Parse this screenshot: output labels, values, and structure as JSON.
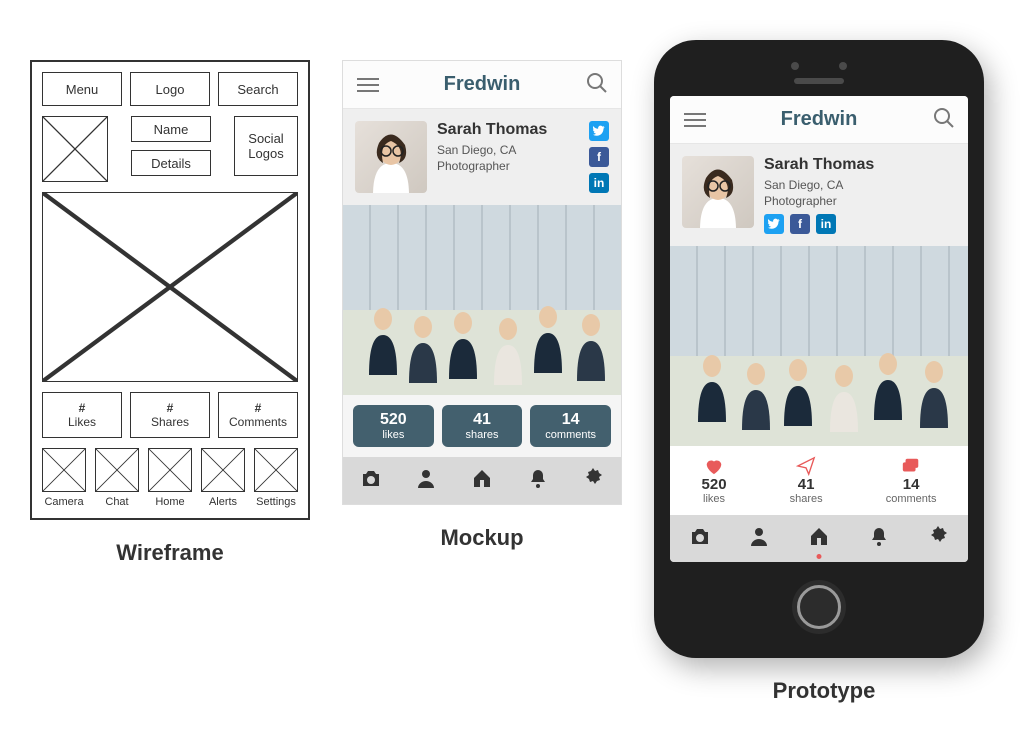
{
  "captions": {
    "wireframe": "Wireframe",
    "mockup": "Mockup",
    "prototype": "Prototype"
  },
  "wireframe": {
    "header": {
      "menu": "Menu",
      "logo": "Logo",
      "search": "Search"
    },
    "profile": {
      "name": "Name",
      "details": "Details",
      "social": "Social\nLogos"
    },
    "stats_prefix": "#",
    "stats": {
      "likes": "Likes",
      "shares": "Shares",
      "comments": "Comments"
    },
    "nav": {
      "camera": "Camera",
      "chat": "Chat",
      "home": "Home",
      "alerts": "Alerts",
      "settings": "Settings"
    }
  },
  "mockup": {
    "header": {
      "title": "Fredwin"
    },
    "profile": {
      "name": "Sarah Thomas",
      "location": "San Diego, CA",
      "role": "Photographer",
      "social": {
        "twitter": "t",
        "facebook": "f",
        "linkedin": "in"
      }
    },
    "stats": {
      "likes": {
        "value": "520",
        "label": "likes"
      },
      "shares": {
        "value": "41",
        "label": "shares"
      },
      "comments": {
        "value": "14",
        "label": "comments"
      }
    }
  },
  "prototype": {
    "header": {
      "title": "Fredwin"
    },
    "profile": {
      "name": "Sarah Thomas",
      "location": "San Diego, CA",
      "role": "Photographer",
      "social": {
        "twitter": "t",
        "facebook": "f",
        "linkedin": "in"
      }
    },
    "stats": {
      "likes": {
        "value": "520",
        "label": "likes"
      },
      "shares": {
        "value": "41",
        "label": "shares"
      },
      "comments": {
        "value": "14",
        "label": "comments"
      }
    }
  },
  "colors": {
    "accent_dark": "#43606e",
    "accent_red": "#e85a5a",
    "twitter": "#1DA1F2",
    "facebook": "#3b5998",
    "linkedin": "#0077b5"
  }
}
